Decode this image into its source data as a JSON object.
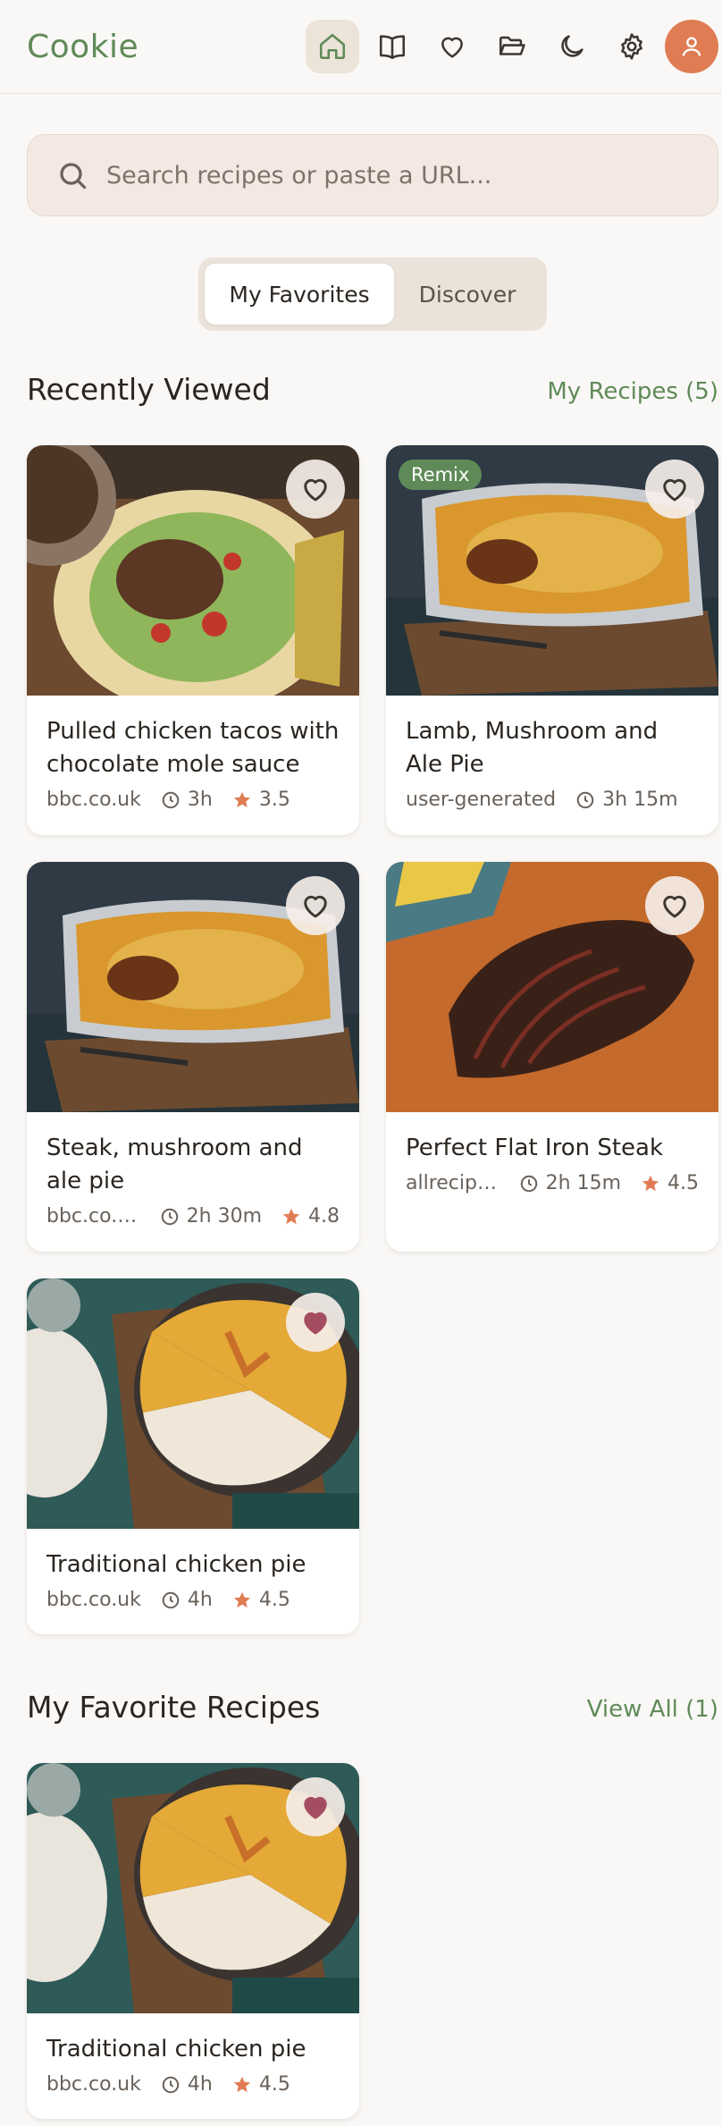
{
  "app": {
    "brand": "Cookie"
  },
  "nav": {
    "items": [
      {
        "icon": "home-icon",
        "active": true
      },
      {
        "icon": "book-icon",
        "active": false
      },
      {
        "icon": "heart-icon",
        "active": false
      },
      {
        "icon": "folder-icon",
        "active": false
      },
      {
        "icon": "moon-icon",
        "active": false
      },
      {
        "icon": "gear-icon",
        "active": false
      }
    ],
    "avatar_icon": "user-icon"
  },
  "search": {
    "placeholder": "Search recipes or paste a URL..."
  },
  "tabs": [
    {
      "label": "My Favorites",
      "active": true
    },
    {
      "label": "Discover",
      "active": false
    }
  ],
  "recently_viewed": {
    "title": "Recently Viewed",
    "link": "My Recipes (5)",
    "cards": [
      {
        "title": "Pulled chicken tacos with chocolate mole sauce",
        "source": "bbc.co.uk",
        "time": "3h",
        "rating": "3.5",
        "favorite": false,
        "badge": ""
      },
      {
        "title": "Lamb, Mushroom and Ale Pie",
        "source": "user-generated",
        "time": "3h 15m",
        "rating": "",
        "favorite": false,
        "badge": "Remix"
      },
      {
        "title": "Steak, mushroom and ale pie",
        "source": "bbc.co.uk",
        "time": "2h 30m",
        "rating": "4.8",
        "favorite": false,
        "badge": ""
      },
      {
        "title": "Perfect Flat Iron Steak",
        "source": "allrecipe…",
        "time": "2h 15m",
        "rating": "4.5",
        "favorite": false,
        "badge": ""
      },
      {
        "title": "Traditional chicken pie",
        "source": "bbc.co.uk",
        "time": "4h",
        "rating": "4.5",
        "favorite": true,
        "badge": ""
      }
    ]
  },
  "favorites": {
    "title": "My Favorite Recipes",
    "link": "View All (1)",
    "cards": [
      {
        "title": "Traditional chicken pie",
        "source": "bbc.co.uk",
        "time": "4h",
        "rating": "4.5",
        "favorite": true
      }
    ]
  },
  "colors": {
    "accent": "#5f8a58",
    "avatar": "#e07c53",
    "heart_on": "#a54d60",
    "star": "#e07c53"
  }
}
